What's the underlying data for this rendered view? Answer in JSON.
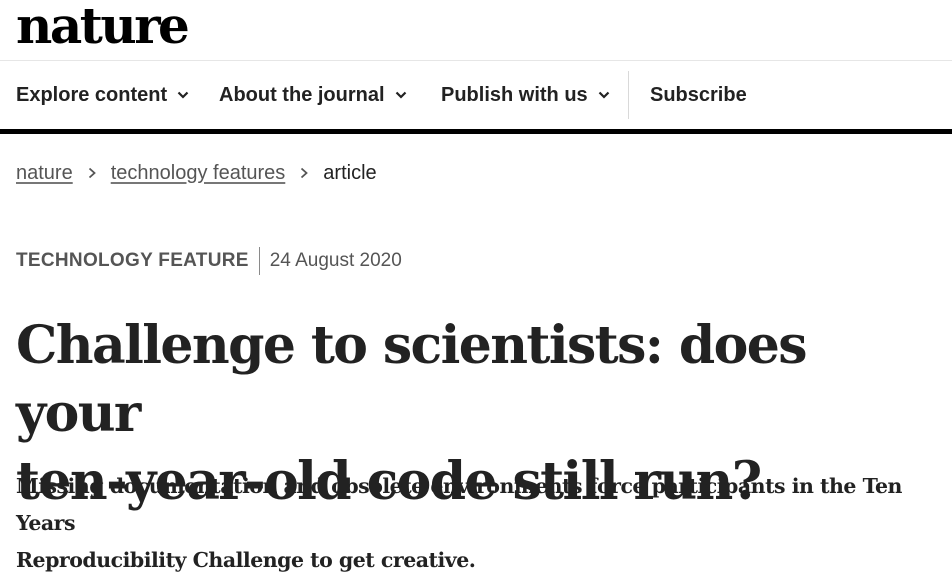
{
  "header": {
    "logo": "nature"
  },
  "nav": {
    "items": [
      {
        "label": "Explore content",
        "has_dropdown": true
      },
      {
        "label": "About the journal",
        "has_dropdown": true
      },
      {
        "label": "Publish with us",
        "has_dropdown": true
      },
      {
        "label": "Subscribe",
        "has_dropdown": false
      }
    ]
  },
  "breadcrumb": {
    "items": [
      "nature",
      "technology features",
      "article"
    ]
  },
  "article": {
    "type": "TECHNOLOGY FEATURE",
    "date": "24 August 2020",
    "title_line1": "Challenge to scientists: does your",
    "title_line2": "ten-year-old code still run?",
    "standfirst_line1": "Missing documentation and obsolete environments force participants in the Ten Years",
    "standfirst_line2": "Reproducibility Challenge to get creative."
  },
  "colors": {
    "text": "#222222",
    "muted": "#555555",
    "nav_bar": "#000000"
  }
}
